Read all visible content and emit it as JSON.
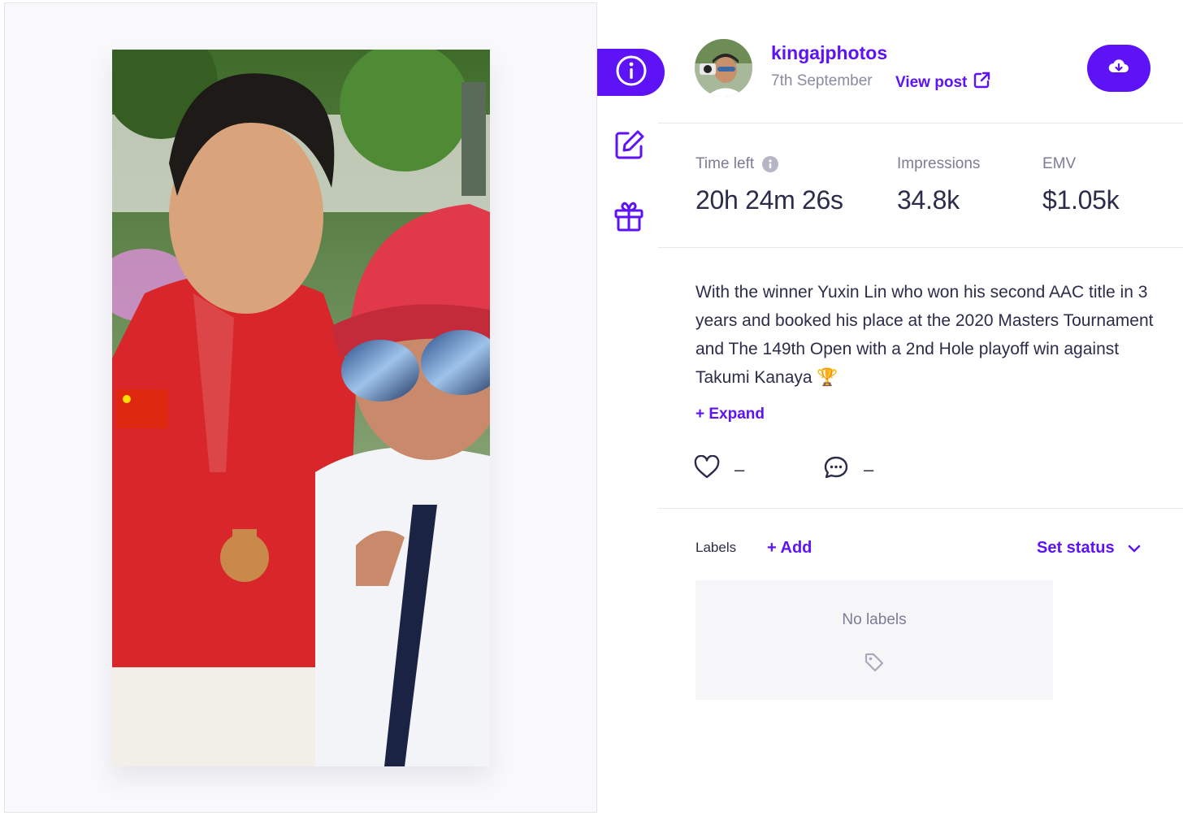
{
  "post": {
    "username": "kingajphotos",
    "date": "7th September",
    "view_post_label": "View post",
    "caption": "With the winner Yuxin Lin who won his second AAC title in 3 years and booked his place at the 2020 Masters Tournament and The 149th Open with a 2nd Hole playoff win against Takumi Kanaya 🏆",
    "expand_label": "+ Expand"
  },
  "stats": {
    "time_left_label": "Time left",
    "time_left_value": "20h 24m 26s",
    "impressions_label": "Impressions",
    "impressions_value": "34.8k",
    "emv_label": "EMV",
    "emv_value": "$1.05k"
  },
  "engagement": {
    "likes": "–",
    "comments": "–"
  },
  "labels": {
    "title": "Labels",
    "add_label": "+ Add",
    "set_status_label": "Set status",
    "empty_text": "No labels"
  },
  "colors": {
    "accent": "#5e12f6",
    "muted": "#7c7c96",
    "text": "#2b2d4a"
  },
  "icons": {
    "rail": [
      "info-icon",
      "edit-icon",
      "gift-icon"
    ],
    "header": [
      "external-link-icon",
      "cloud-download-icon"
    ],
    "engagement": [
      "heart-icon",
      "comment-icon"
    ],
    "labels": [
      "chevron-down-icon",
      "tag-icon"
    ]
  }
}
